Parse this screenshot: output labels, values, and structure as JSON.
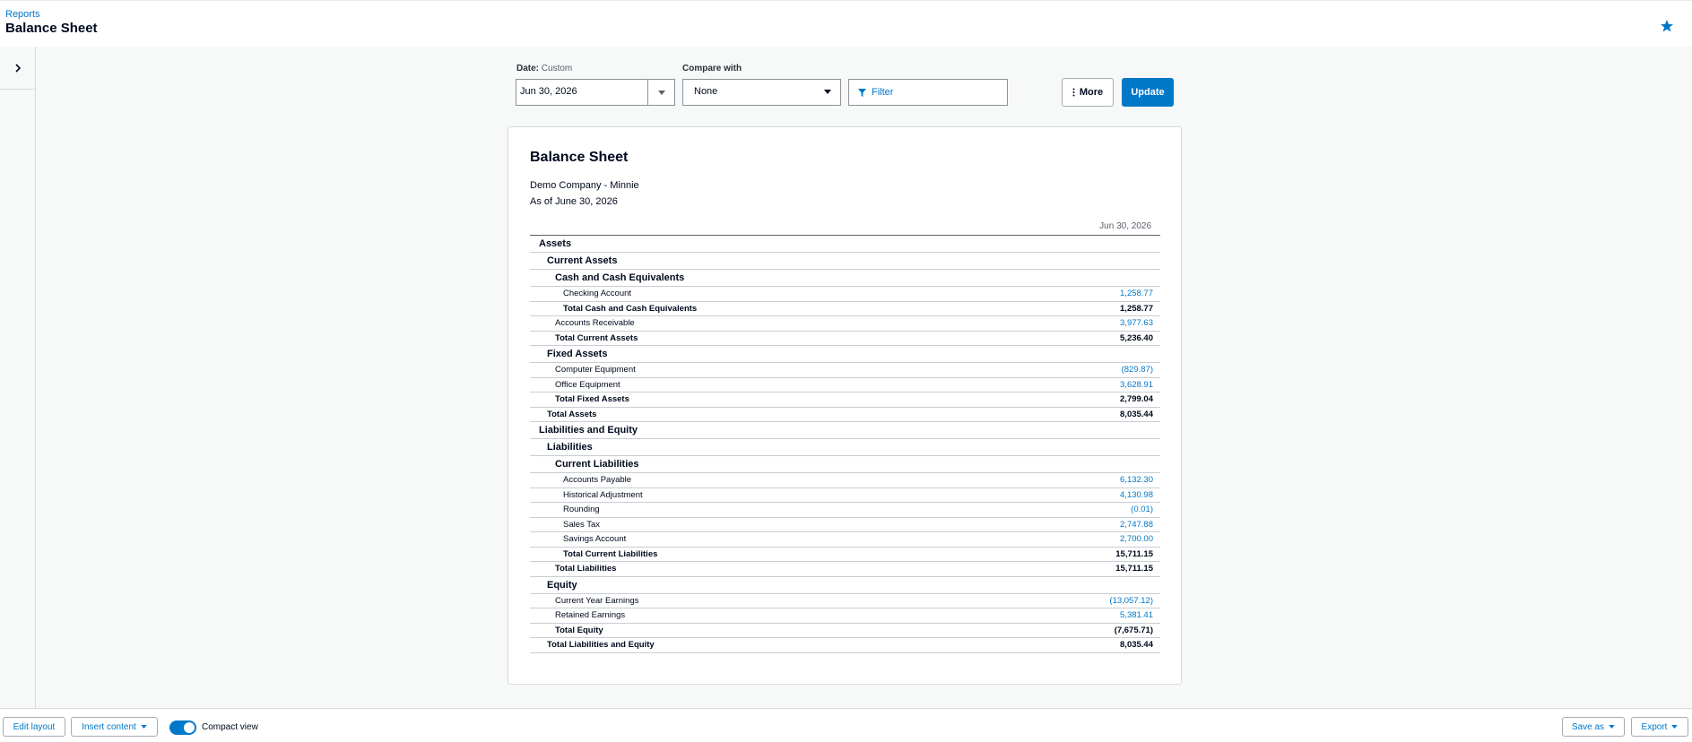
{
  "header": {
    "breadcrumb": "Reports",
    "title": "Balance Sheet"
  },
  "controls": {
    "date_label": "Date:",
    "date_mode": "Custom",
    "date_value": "Jun 30, 2026",
    "compare_label": "Compare with",
    "compare_value": "None",
    "filter_label": "Filter",
    "more_label": "More",
    "update_label": "Update"
  },
  "report": {
    "title": "Balance Sheet",
    "company": "Demo Company - Minnie",
    "as_of": "As of June 30, 2026",
    "column_header": "Jun 30, 2026",
    "rows": [
      {
        "type": "h1",
        "indent": 0,
        "label": "Assets",
        "amount": ""
      },
      {
        "type": "h2",
        "indent": 1,
        "label": "Current Assets",
        "amount": ""
      },
      {
        "type": "h3",
        "indent": 2,
        "label": "Cash and Cash Equivalents",
        "amount": ""
      },
      {
        "type": "line",
        "indent": 3,
        "label": "Checking Account",
        "amount": "1,258.77"
      },
      {
        "type": "total",
        "indent": 3,
        "label": "Total Cash and Cash Equivalents",
        "amount": "1,258.77"
      },
      {
        "type": "line",
        "indent": 2,
        "label": "Accounts Receivable",
        "amount": "3,977.63"
      },
      {
        "type": "total",
        "indent": 2,
        "label": "Total Current Assets",
        "amount": "5,236.40"
      },
      {
        "type": "h2",
        "indent": 1,
        "label": "Fixed Assets",
        "amount": ""
      },
      {
        "type": "line",
        "indent": 2,
        "label": "Computer Equipment",
        "amount": "(829.87)"
      },
      {
        "type": "line",
        "indent": 2,
        "label": "Office Equipment",
        "amount": "3,628.91"
      },
      {
        "type": "total",
        "indent": 2,
        "label": "Total Fixed Assets",
        "amount": "2,799.04"
      },
      {
        "type": "total",
        "indent": 1,
        "label": "Total Assets",
        "amount": "8,035.44"
      },
      {
        "type": "h1",
        "indent": 0,
        "label": "Liabilities and Equity",
        "amount": ""
      },
      {
        "type": "h2",
        "indent": 1,
        "label": "Liabilities",
        "amount": ""
      },
      {
        "type": "h3",
        "indent": 2,
        "label": "Current Liabilities",
        "amount": ""
      },
      {
        "type": "line",
        "indent": 3,
        "label": "Accounts Payable",
        "amount": "6,132.30"
      },
      {
        "type": "line",
        "indent": 3,
        "label": "Historical Adjustment",
        "amount": "4,130.98"
      },
      {
        "type": "line",
        "indent": 3,
        "label": "Rounding",
        "amount": "(0.01)"
      },
      {
        "type": "line",
        "indent": 3,
        "label": "Sales Tax",
        "amount": "2,747.88"
      },
      {
        "type": "line",
        "indent": 3,
        "label": "Savings Account",
        "amount": "2,700.00"
      },
      {
        "type": "total",
        "indent": 3,
        "label": "Total Current Liabilities",
        "amount": "15,711.15"
      },
      {
        "type": "total",
        "indent": 2,
        "label": "Total Liabilities",
        "amount": "15,711.15"
      },
      {
        "type": "h2",
        "indent": 1,
        "label": "Equity",
        "amount": ""
      },
      {
        "type": "line",
        "indent": 2,
        "label": "Current Year Earnings",
        "amount": "(13,057.12)"
      },
      {
        "type": "line",
        "indent": 2,
        "label": "Retained Earnings",
        "amount": "5,381.41"
      },
      {
        "type": "total",
        "indent": 2,
        "label": "Total Equity",
        "amount": "(7,675.71)"
      },
      {
        "type": "total",
        "indent": 1,
        "label": "Total Liabilities and Equity",
        "amount": "8,035.44"
      }
    ]
  },
  "footer": {
    "edit_layout": "Edit layout",
    "insert_content": "Insert content",
    "compact_view": "Compact view",
    "compact_view_on": true,
    "save_as": "Save as",
    "export": "Export"
  },
  "colors": {
    "accent": "#0078c8",
    "text": "#000a1e",
    "background": "#f7f8f8"
  },
  "icons": [
    "star-icon",
    "chevron-right-icon",
    "calendar-caret-icon",
    "caret-down-icon",
    "filter-icon",
    "more-vertical-icon"
  ]
}
